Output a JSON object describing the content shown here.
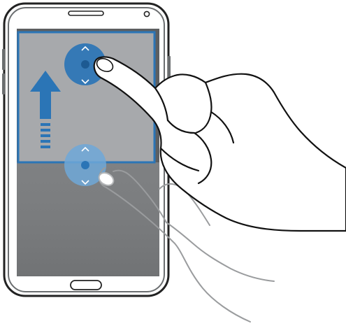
{
  "illustration": {
    "device": "smartphone",
    "gesture": "drag-multi-window-divider-up",
    "icons": [
      "phone-icon",
      "hand-icon",
      "drag-handle-icon",
      "up-arrow-icon",
      "chevron-up-icon",
      "chevron-down-icon"
    ],
    "colors": {
      "accent_blue": "#2b75b6",
      "handle_blue": "#6ea8d8",
      "top_window_gray": "#a7a9ac",
      "bottom_window_gray": "#7f8183",
      "frame_gray": "#6b6e70",
      "outline_black": "#222222"
    }
  }
}
